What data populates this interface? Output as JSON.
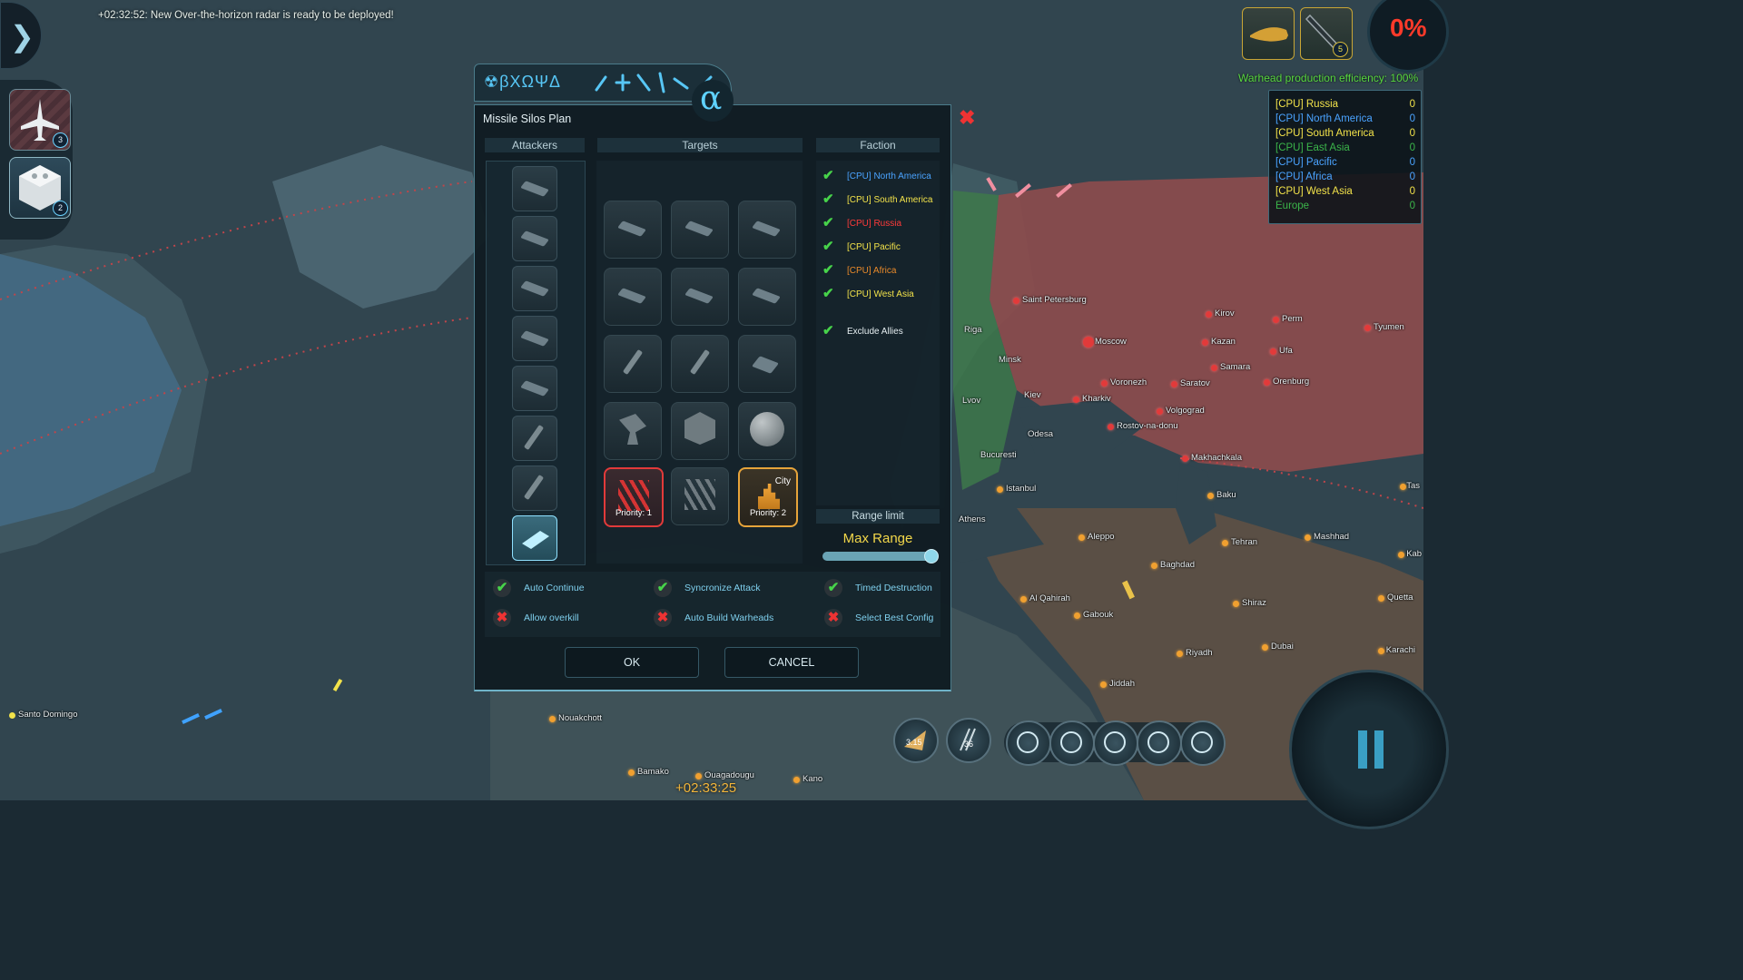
{
  "message": "+02:32:52: New Over-the-horizon radar is ready to be deployed!",
  "side_cards": [
    {
      "icon": "fighter-jet-icon",
      "count": "3"
    },
    {
      "icon": "silo-module-icon",
      "count": "2"
    }
  ],
  "resources": {
    "warhead_count": "5",
    "percent": "0%",
    "efficiency": "Warhead production efficiency: 100%"
  },
  "scores": [
    {
      "name": "[CPU] Russia",
      "value": "0",
      "color": "#f2e24a"
    },
    {
      "name": "[CPU] North America",
      "value": "0",
      "color": "#4aa3ff"
    },
    {
      "name": "[CPU] South America",
      "value": "0",
      "color": "#f2e24a"
    },
    {
      "name": "[CPU] East Asia",
      "value": "0",
      "color": "#3bb54a"
    },
    {
      "name": "[CPU] Pacific",
      "value": "0",
      "color": "#4aa3ff"
    },
    {
      "name": "[CPU] Africa",
      "value": "0",
      "color": "#4aa3ff"
    },
    {
      "name": "[CPU] West Asia",
      "value": "0",
      "color": "#f2e24a"
    },
    {
      "name": "Europe",
      "value": "0",
      "color": "#3bb54a"
    }
  ],
  "dialog": {
    "symbols": "☢βΧΩΨΔ",
    "alpha": "α",
    "title": "Missile Silos Plan",
    "close": "✖",
    "columns": {
      "attackers": "Attackers",
      "targets": "Targets",
      "faction": "Faction"
    },
    "targets": {
      "p1_label": "Priority: 1",
      "p2_label": "Priority: 2",
      "city_tag": "City"
    },
    "factions": [
      {
        "label": "[CPU] North America",
        "color": "#4aa3ff"
      },
      {
        "label": "[CPU] South America",
        "color": "#f2e24a"
      },
      {
        "label": "[CPU] Russia",
        "color": "#ff3a3a"
      },
      {
        "label": "[CPU] Pacific",
        "color": "#f2e24a"
      },
      {
        "label": "[CPU] Africa",
        "color": "#e98a2a"
      },
      {
        "label": "[CPU] West Asia",
        "color": "#f2e24a"
      }
    ],
    "exclude_allies": "Exclude Allies",
    "range_limit": "Range limit",
    "range_value": "Max Range",
    "range_fraction": 1.0,
    "options": {
      "auto_continue": "Auto Continue",
      "sync_attack": "Syncronize Attack",
      "timed_destruction": "Timed Destruction",
      "allow_overkill": "Allow overkill",
      "auto_build": "Auto Build Warheads",
      "select_best": "Select Best Config"
    },
    "ok": "OK",
    "cancel": "CANCEL"
  },
  "cities": [
    {
      "name": "Saint Petersburg",
      "kind": "red"
    },
    {
      "name": "Moscow",
      "kind": "red"
    },
    {
      "name": "Kirov",
      "kind": "red"
    },
    {
      "name": "Perm",
      "kind": "red"
    },
    {
      "name": "Tyumen",
      "kind": "red"
    },
    {
      "name": "Kazan",
      "kind": "red"
    },
    {
      "name": "Ufa",
      "kind": "red"
    },
    {
      "name": "Samara",
      "kind": "red"
    },
    {
      "name": "Orenburg",
      "kind": "red"
    },
    {
      "name": "Voronezh",
      "kind": "red"
    },
    {
      "name": "Saratov",
      "kind": "red"
    },
    {
      "name": "Kharkiv",
      "kind": "red"
    },
    {
      "name": "Volgograd",
      "kind": "red"
    },
    {
      "name": "Rostov-na-donu",
      "kind": "red"
    },
    {
      "name": "Makhachkala",
      "kind": "red"
    },
    {
      "name": "Riga",
      "kind": "none"
    },
    {
      "name": "Minsk",
      "kind": "none"
    },
    {
      "name": "Lvov",
      "kind": "none"
    },
    {
      "name": "Kiev",
      "kind": "none"
    },
    {
      "name": "Odesa",
      "kind": "none"
    },
    {
      "name": "Bucuresti",
      "kind": "none"
    },
    {
      "name": "Athens",
      "kind": "none"
    },
    {
      "name": "Istanbul",
      "kind": "orange"
    },
    {
      "name": "Baku",
      "kind": "orange"
    },
    {
      "name": "Aleppo",
      "kind": "orange"
    },
    {
      "name": "Tehran",
      "kind": "orange"
    },
    {
      "name": "Mashhad",
      "kind": "orange"
    },
    {
      "name": "Baghdad",
      "kind": "orange"
    },
    {
      "name": "Al Qahirah",
      "kind": "orange"
    },
    {
      "name": "Shiraz",
      "kind": "orange"
    },
    {
      "name": "Quetta",
      "kind": "orange"
    },
    {
      "name": "Gabouk",
      "kind": "orange"
    },
    {
      "name": "Riyadh",
      "kind": "orange"
    },
    {
      "name": "Dubai",
      "kind": "orange"
    },
    {
      "name": "Karachi",
      "kind": "orange"
    },
    {
      "name": "Jiddah",
      "kind": "orange"
    },
    {
      "name": "Kab",
      "kind": "orange"
    },
    {
      "name": "Tas",
      "kind": "orange"
    },
    {
      "name": "Santo Domingo",
      "kind": "yellow"
    },
    {
      "name": "Nouakchott",
      "kind": "orange"
    },
    {
      "name": "Bamako",
      "kind": "orange"
    },
    {
      "name": "Ouagadougu",
      "kind": "orange"
    },
    {
      "name": "Kano",
      "kind": "orange"
    }
  ],
  "clock": "+02:33:25",
  "bottom": {
    "satellite_count": "3.15",
    "silo_count": "36"
  }
}
